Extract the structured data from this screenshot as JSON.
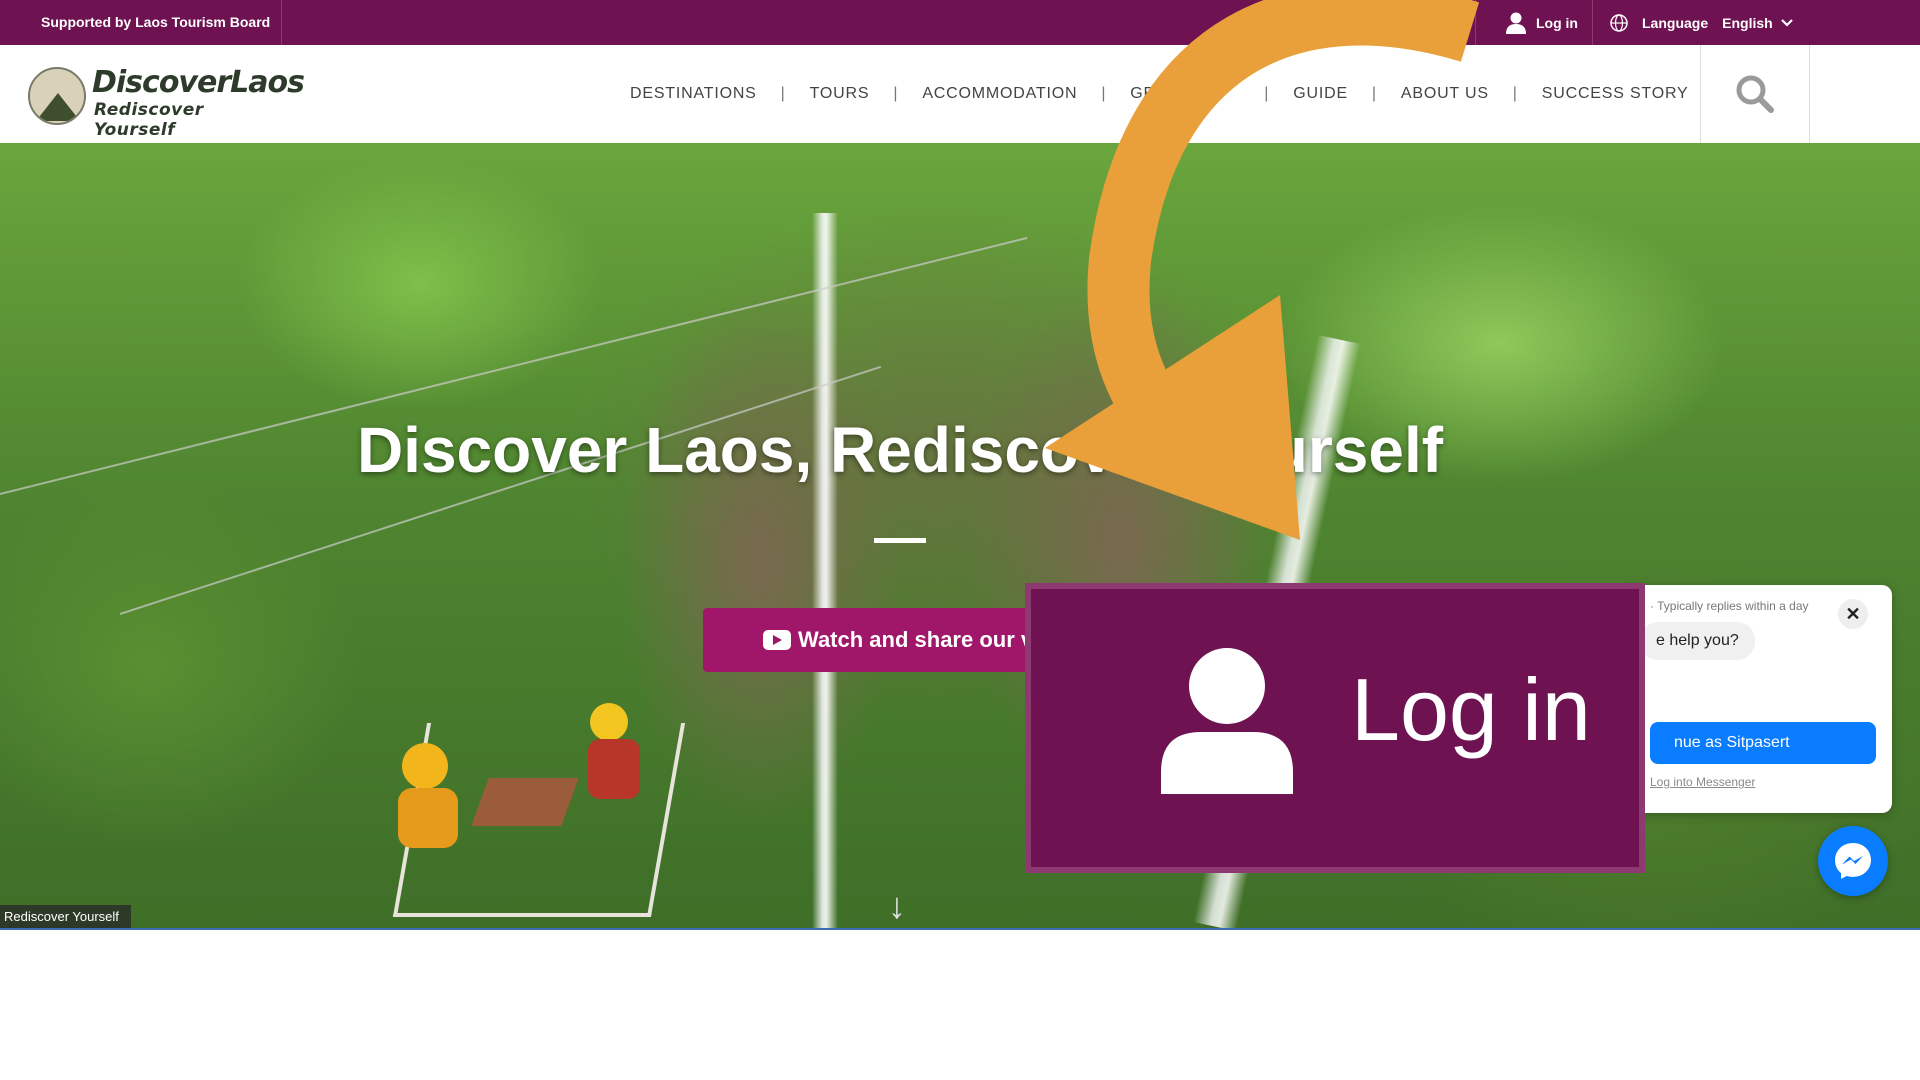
{
  "topbar": {
    "support_text": "Supported by Laos Tourism Board",
    "login_label": "Log in",
    "language_label": "Language",
    "language_value": "English"
  },
  "header": {
    "logo_title": "DiscoverLaos",
    "logo_tagline": "Rediscover Yourself",
    "nav": [
      "DESTINATIONS",
      "TOURS",
      "ACCOMMODATION",
      "GET IN",
      "GUIDE",
      "ABOUT US",
      "SUCCESS STORY"
    ]
  },
  "hero": {
    "title": "Discover Laos, Rediscover Yourself",
    "watch_button": "Watch and share our v",
    "caption": "Rediscover Yourself"
  },
  "messenger": {
    "reply_info": "· Typically replies within a day",
    "bubble_text": "e help you?",
    "continue_button": "nue as Sitpasert",
    "login_link": "Log into Messenger",
    "close_symbol": "✕"
  },
  "callout": {
    "label": "Log in"
  },
  "colors": {
    "brand_purple": "#6e1251",
    "button_magenta": "#a0176a",
    "messenger_blue": "#0a7cff",
    "annotation_orange": "#e9a03a"
  }
}
